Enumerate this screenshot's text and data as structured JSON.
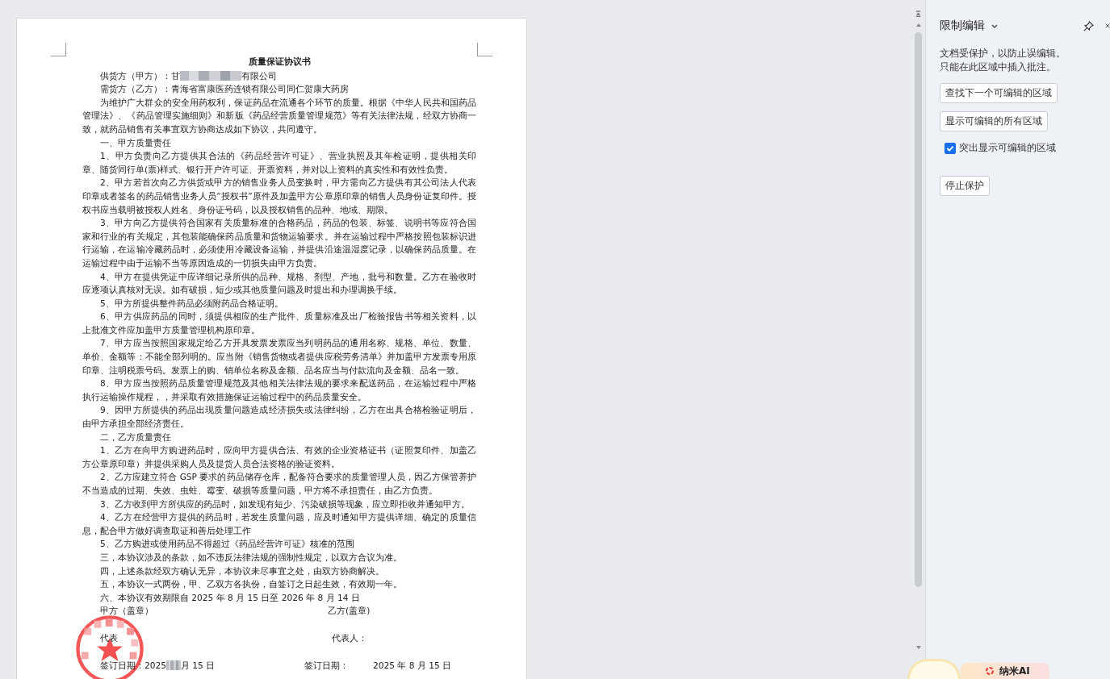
{
  "document": {
    "title": "质量保证协议书",
    "supplier": {
      "label": "供货方（甲方）：甘",
      "suffix": "有限公司"
    },
    "buyer": "需货方（乙方）：青海省富康医药连锁有限公司同仁贺康大药房",
    "paragraphs": [
      "为维护广大群众的安全用药权利，保证药品在流通各个环节的质量。根据《中华人民共和国药品管理法》、《药品管理实施细则》和新版《药品经营质量管理规范》等有关法律法规，经双方协商一致，就药品销售有关事宜双方协商达成如下协议，共同遵守。",
      "一、甲方质量责任",
      "1、甲方负责向乙方提供其合法的《药品经营许可证》、营业执照及其年检证明，提供相关印章、随货同行单(票)样式、银行开户许可证、开票资料，并对以上资料的真实性和有效性负责。",
      "2、甲方若首次向乙方供货或甲方的销售业务人员变换时，甲方需向乙方提供有其公司法人代表印章或者签名的药品销售业务人员“授权书”原件及加盖甲方公章原印章的销售人员身份证复印件。授权书应当载明被授权人姓名、身份证号码，以及授权销售的品种、地域、期限。",
      "3、甲方向乙方提供符合国家有关质量标准的合格药品，药品的包装、标签、说明书等应符合国家和行业的有关规定，其包装能确保药品质量和货物运输要求。并在运输过程中严格按照包装标识进行运输，在运输冷藏药品时，必须使用冷藏设备运输，并提供沿途温湿度记录，以确保药品质量。在运输过程中由于运输不当等原因造成的一切损失由甲方负责。",
      "4、甲方在提供凭证中应详细记录所供的品种、规格、剂型、产地，批号和数量。乙方在验收时应逐项认真核对无误。如有破损，短少或其他质量问题及时提出和办理调换手续。",
      "5、甲方所提供整件药品必须附药品合格证明。",
      "6、甲方供应药品的同时，须提供相应的生产批件、质量标准及出厂检验报告书等相关资料，以上批准文件应加盖甲方质量管理机构原印章。",
      "7、甲方应当按照国家规定给乙方开具发票发票应当列明药品的通用名称、规格、单位、数量、单价、金额等：不能全部列明的。应当附《销售货物或者提供应税劳务清单》并加盖甲方发票专用原印章、注明税票号码。发票上的购、销单位名称及金额、品名应当与付款流向及金额、品名一致。",
      "8、甲方应当按照药品质量管理规范及其他相关法律法规的要求来配送药品，在运输过程中严格执行运输操作规程，，并采取有效措施保证运输过程中的药品质量安全。",
      "9、因甲方所提供的药品出现质量问题造成经济损失或法律纠纷，乙方在出具合格检验证明后，由甲方承担全部经济责任。",
      "二，乙方质量责任",
      "1、乙方在向甲方购进药品时，应向甲方提供合法、有效的企业资格证书（证照复印件、加盖乙方公章原印章）并提供采购人员及提货人员合法资格的验证资料。",
      "2、乙方应建立符合 GSP 要求的药品储存仓库，配备符合要求的质量管理人员，因乙方保管养护不当造成的过期、失效、虫蛀、霉变、破损等质量问题，甲方将不承担责任，由乙方负责。",
      "3、乙方收到甲方所供应的药品时，如发现有短少、污染破损等现象，应立即拒收并通知甲方。",
      "4、乙方在经营甲方提供的药品时，若发生质量问题，应及时通知甲方提供详细、确定的质量信息，配合甲方做好调查取证和善后处理工作",
      "5、乙方购进或使用药品不得超过《药品经营许可证》核准的范围",
      "三，本协议涉及的条款，如不违反法律法规的强制性规定，以双方合议为准。",
      "四，上述条款经双方确认无异，本协议未尽事宜之处，由双方协商解决。",
      "五，本协议一式两份，甲、乙双方各执份，自签订之日起生效，有效期一年。",
      "六、本协议有效期限自 2025 年 8 月 15 日至 2026 年 8 月 14 日"
    ],
    "signature": {
      "party_a": "甲方（盖章）",
      "party_b": "乙方(盖章)",
      "rep_a": "代表",
      "rep_b": "代表人：",
      "date_a_prefix": "签订日期：2025",
      "date_a_suffix": "月 15 日",
      "date_b_label": "签订日期：",
      "date_b_value": "2025 年 8 月 15 日"
    }
  },
  "panel": {
    "title": "限制编辑",
    "message": [
      "文档受保护，以防止误编辑。",
      "只能在此区域中插入批注。"
    ],
    "buttons": [
      "查找下一个可编辑的区域",
      "显示可编辑的所有区域"
    ],
    "highlight": {
      "label": "突出显示可编辑的区域",
      "checked": true
    },
    "stop_button": "停止保护"
  },
  "assistant": {
    "label": "纳米AI"
  }
}
